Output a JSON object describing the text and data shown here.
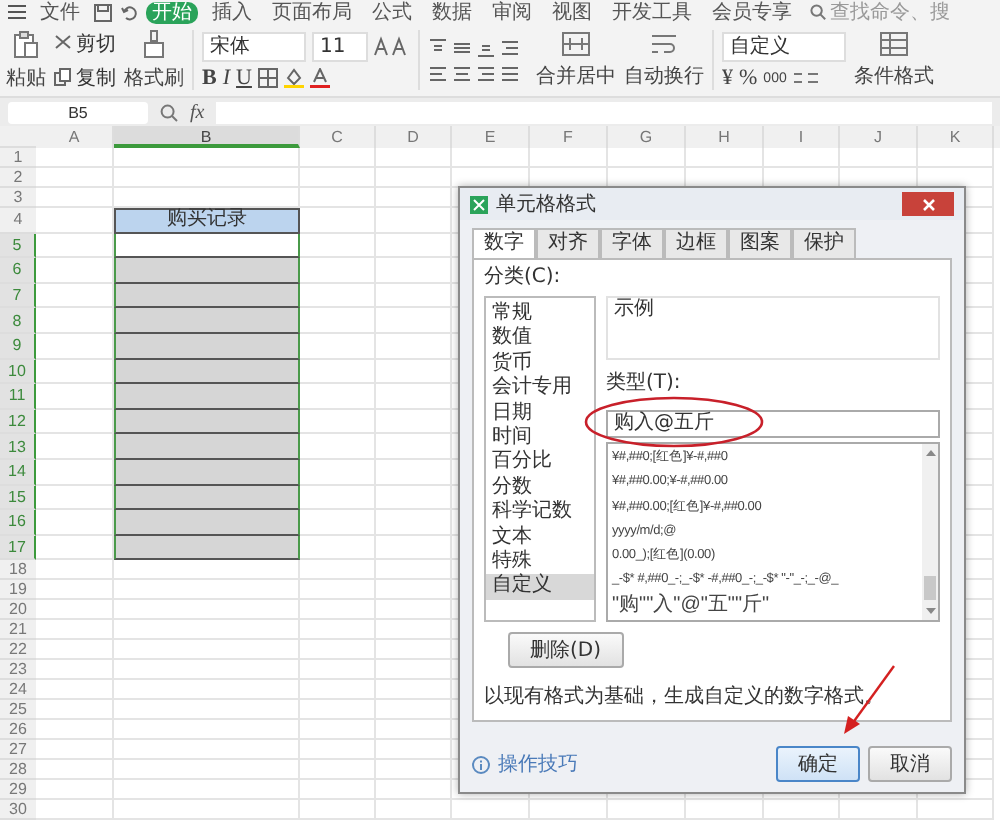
{
  "menu": {
    "file": "文件",
    "tabs": [
      {
        "label": "开始",
        "selected": true
      },
      {
        "label": "插入",
        "selected": false
      },
      {
        "label": "页面布局",
        "selected": false
      },
      {
        "label": "公式",
        "selected": false
      },
      {
        "label": "数据",
        "selected": false
      },
      {
        "label": "审阅",
        "selected": false
      },
      {
        "label": "视图",
        "selected": false
      },
      {
        "label": "开发工具",
        "selected": false
      },
      {
        "label": "会员专享",
        "selected": false
      }
    ],
    "search": "查找命令、搜"
  },
  "toolbar": {
    "paste": "粘贴",
    "cut": "剪切",
    "copy": "复制",
    "format_painter": "格式刷",
    "font": "宋体",
    "font_size": "11",
    "bold": "B",
    "italic": "I",
    "underline": "U",
    "merge": "合并居中",
    "wrap": "自动换行",
    "number_format": "自定义",
    "currency": "¥",
    "percent": "%",
    "thousands": "000",
    "conditional_format": "条件格式"
  },
  "formula_bar": {
    "cell_ref": "B5",
    "fx": "fx"
  },
  "sheet": {
    "columns": [
      {
        "label": "A",
        "selected": false
      },
      {
        "label": "B",
        "selected": true
      },
      {
        "label": "C",
        "selected": false
      },
      {
        "label": "D",
        "selected": false
      },
      {
        "label": "E",
        "selected": false
      },
      {
        "label": "F",
        "selected": false
      },
      {
        "label": "G",
        "selected": false
      },
      {
        "label": "H",
        "selected": false
      },
      {
        "label": "I",
        "selected": false
      },
      {
        "label": "J",
        "selected": false
      },
      {
        "label": "K",
        "selected": false
      }
    ],
    "rows": [
      {
        "label": "1",
        "selected": false,
        "kind": "plain"
      },
      {
        "label": "2",
        "selected": false,
        "kind": "plain"
      },
      {
        "label": "3",
        "selected": false,
        "kind": "plain"
      },
      {
        "label": "4",
        "selected": false,
        "kind": "title",
        "text": "购买记录"
      },
      {
        "label": "5",
        "selected": true,
        "kind": "active"
      },
      {
        "label": "6",
        "selected": true,
        "kind": "filled"
      },
      {
        "label": "7",
        "selected": true,
        "kind": "filled"
      },
      {
        "label": "8",
        "selected": true,
        "kind": "filled"
      },
      {
        "label": "9",
        "selected": true,
        "kind": "filled"
      },
      {
        "label": "10",
        "selected": true,
        "kind": "filled"
      },
      {
        "label": "11",
        "selected": true,
        "kind": "filled"
      },
      {
        "label": "12",
        "selected": true,
        "kind": "filled"
      },
      {
        "label": "13",
        "selected": true,
        "kind": "filled"
      },
      {
        "label": "14",
        "selected": true,
        "kind": "filled"
      },
      {
        "label": "15",
        "selected": true,
        "kind": "filled"
      },
      {
        "label": "16",
        "selected": true,
        "kind": "filled"
      },
      {
        "label": "17",
        "selected": true,
        "kind": "filled"
      },
      {
        "label": "18",
        "selected": false,
        "kind": "plain"
      },
      {
        "label": "19",
        "selected": false,
        "kind": "plain"
      },
      {
        "label": "20",
        "selected": false,
        "kind": "plain"
      },
      {
        "label": "21",
        "selected": false,
        "kind": "plain"
      },
      {
        "label": "22",
        "selected": false,
        "kind": "plain"
      },
      {
        "label": "23",
        "selected": false,
        "kind": "plain"
      },
      {
        "label": "24",
        "selected": false,
        "kind": "plain"
      },
      {
        "label": "25",
        "selected": false,
        "kind": "plain"
      },
      {
        "label": "26",
        "selected": false,
        "kind": "plain"
      },
      {
        "label": "27",
        "selected": false,
        "kind": "plain"
      },
      {
        "label": "28",
        "selected": false,
        "kind": "plain"
      },
      {
        "label": "29",
        "selected": false,
        "kind": "plain"
      },
      {
        "label": "30",
        "selected": false,
        "kind": "plain"
      }
    ]
  },
  "dialog": {
    "title": "单元格格式",
    "tabs": [
      {
        "label": "数字",
        "selected": true
      },
      {
        "label": "对齐",
        "selected": false
      },
      {
        "label": "字体",
        "selected": false
      },
      {
        "label": "边框",
        "selected": false
      },
      {
        "label": "图案",
        "selected": false
      },
      {
        "label": "保护",
        "selected": false
      }
    ],
    "category_label": "分类(C):",
    "categories": [
      {
        "label": "常规",
        "selected": false
      },
      {
        "label": "数值",
        "selected": false
      },
      {
        "label": "货币",
        "selected": false
      },
      {
        "label": "会计专用",
        "selected": false
      },
      {
        "label": "日期",
        "selected": false
      },
      {
        "label": "时间",
        "selected": false
      },
      {
        "label": "百分比",
        "selected": false
      },
      {
        "label": "分数",
        "selected": false
      },
      {
        "label": "科学记数",
        "selected": false
      },
      {
        "label": "文本",
        "selected": false
      },
      {
        "label": "特殊",
        "selected": false
      },
      {
        "label": "自定义",
        "selected": true
      }
    ],
    "sample_label": "示例",
    "type_label": "类型(T):",
    "type_value": "购入@五斤",
    "formats": [
      "¥#,##0;[红色]¥-#,##0",
      "¥#,##0.00;¥-#,##0.00",
      "¥#,##0.00;[红色]¥-#,##0.00",
      "yyyy/m/d;@",
      "0.00_);[红色](0.00)",
      "_-$* #,##0_-;_-$* -#,##0_-;_-$* \"-\"_-;_-@_",
      "\"购\"\"入\"@\"五\"\"斤\""
    ],
    "delete": "删除(D)",
    "description": "以现有格式为基础，生成自定义的数字格式。",
    "help": "操作技巧",
    "ok": "确定",
    "cancel": "取消"
  }
}
